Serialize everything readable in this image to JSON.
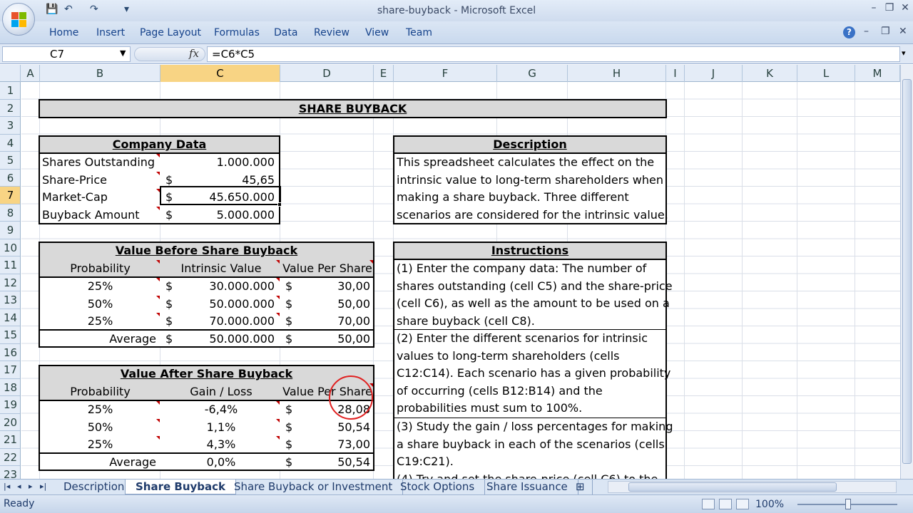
{
  "window": {
    "title": "share-buyback - Microsoft Excel",
    "qat_save": "💾",
    "qat_undo": "↶",
    "qat_redo": "↷",
    "qat_more": "▾",
    "min": "–",
    "restore": "❐",
    "close": "✕"
  },
  "ribbon": {
    "tabs": [
      "Home",
      "Insert",
      "Page Layout",
      "Formulas",
      "Data",
      "Review",
      "View",
      "Team"
    ],
    "help": "?",
    "doc_min": "–",
    "doc_restore": "❐",
    "doc_close": "✕"
  },
  "formula_bar": {
    "name_box": "C7",
    "fx": "fx",
    "formula": "=C6*C5"
  },
  "grid": {
    "columns": [
      "A",
      "B",
      "C",
      "D",
      "E",
      "F",
      "G",
      "H",
      "I",
      "J",
      "K",
      "L",
      "M"
    ],
    "selected_column": "C",
    "rows": [
      "1",
      "2",
      "3",
      "4",
      "5",
      "6",
      "7",
      "8",
      "9",
      "10",
      "11",
      "12",
      "13",
      "14",
      "15",
      "16",
      "17",
      "18",
      "19",
      "20",
      "21",
      "22",
      "23"
    ],
    "selected_row": "7"
  },
  "sheet": {
    "title": "SHARE BUYBACK",
    "company": {
      "header": "Company Data",
      "rows": [
        {
          "label": "Shares Outstanding",
          "currency": "",
          "value": "1.000.000"
        },
        {
          "label": "Share-Price",
          "currency": "$",
          "value": "45,65"
        },
        {
          "label": "Market-Cap",
          "currency": "$",
          "value": "45.650.000"
        },
        {
          "label": "Buyback Amount",
          "currency": "$",
          "value": "5.000.000"
        }
      ]
    },
    "before": {
      "header": "Value Before Share Buyback",
      "col1": "Probability",
      "col2": "Intrinsic Value",
      "col3": "Value Per Share",
      "rows": [
        {
          "prob": "25%",
          "cur1": "$",
          "val": "30.000.000",
          "cur2": "$",
          "vps": "30,00"
        },
        {
          "prob": "50%",
          "cur1": "$",
          "val": "50.000.000",
          "cur2": "$",
          "vps": "50,00"
        },
        {
          "prob": "25%",
          "cur1": "$",
          "val": "70.000.000",
          "cur2": "$",
          "vps": "70,00"
        }
      ],
      "avg_label": "Average",
      "avg": {
        "cur1": "$",
        "val": "50.000.000",
        "cur2": "$",
        "vps": "50,00"
      }
    },
    "after": {
      "header": "Value After Share Buyback",
      "col1": "Probability",
      "col2": "Gain / Loss",
      "col3": "Value Per Share",
      "rows": [
        {
          "prob": "25%",
          "gl": "-6,4%",
          "cur": "$",
          "vps": "28,08"
        },
        {
          "prob": "50%",
          "gl": "1,1%",
          "cur": "$",
          "vps": "50,54"
        },
        {
          "prob": "25%",
          "gl": "4,3%",
          "cur": "$",
          "vps": "73,00"
        }
      ],
      "avg_label": "Average",
      "avg": {
        "gl": "0,0%",
        "cur": "$",
        "vps": "50,54"
      }
    },
    "description": {
      "header": "Description",
      "lines": [
        "This spreadsheet calculates the effect on the",
        "intrinsic value to long-term shareholders when",
        "making a share buyback. Three different",
        "scenarios are considered for the intrinsic value."
      ]
    },
    "instructions": {
      "header": "Instructions",
      "lines": [
        "(1) Enter the company data: The number of",
        "shares outstanding (cell C5) and the share-price",
        "(cell C6), as well as the amount to be used on a",
        "share buyback (cell C8).",
        "(2) Enter the different scenarios for intrinsic",
        "values to long-term shareholders (cells",
        "C12:C14). Each scenario has a given probability",
        "of occurring (cells B12:B14) and the",
        "probabilities must sum to 100%.",
        "(3) Study the gain / loss percentages for making",
        "a share buyback in each of the scenarios (cells",
        "C19:C21).",
        "(4) Try and set the share-price (cell C6) to the"
      ]
    }
  },
  "sheet_tabs": {
    "tabs": [
      "Description",
      "Share Buyback",
      "Share Buyback or Investment",
      "Stock Options",
      "Share Issuance"
    ],
    "active": "Share Buyback",
    "nav_first": "|◂",
    "nav_prev": "◂",
    "nav_next": "▸",
    "nav_last": "▸|"
  },
  "status_bar": {
    "status": "Ready",
    "zoom": "100%"
  },
  "colors": {
    "selection": "#f8d484",
    "header_bg": "#e4ecf7",
    "table_gray": "#d9d9d9",
    "comment_marker": "#c00000",
    "cursor_ring": "#e02020"
  }
}
